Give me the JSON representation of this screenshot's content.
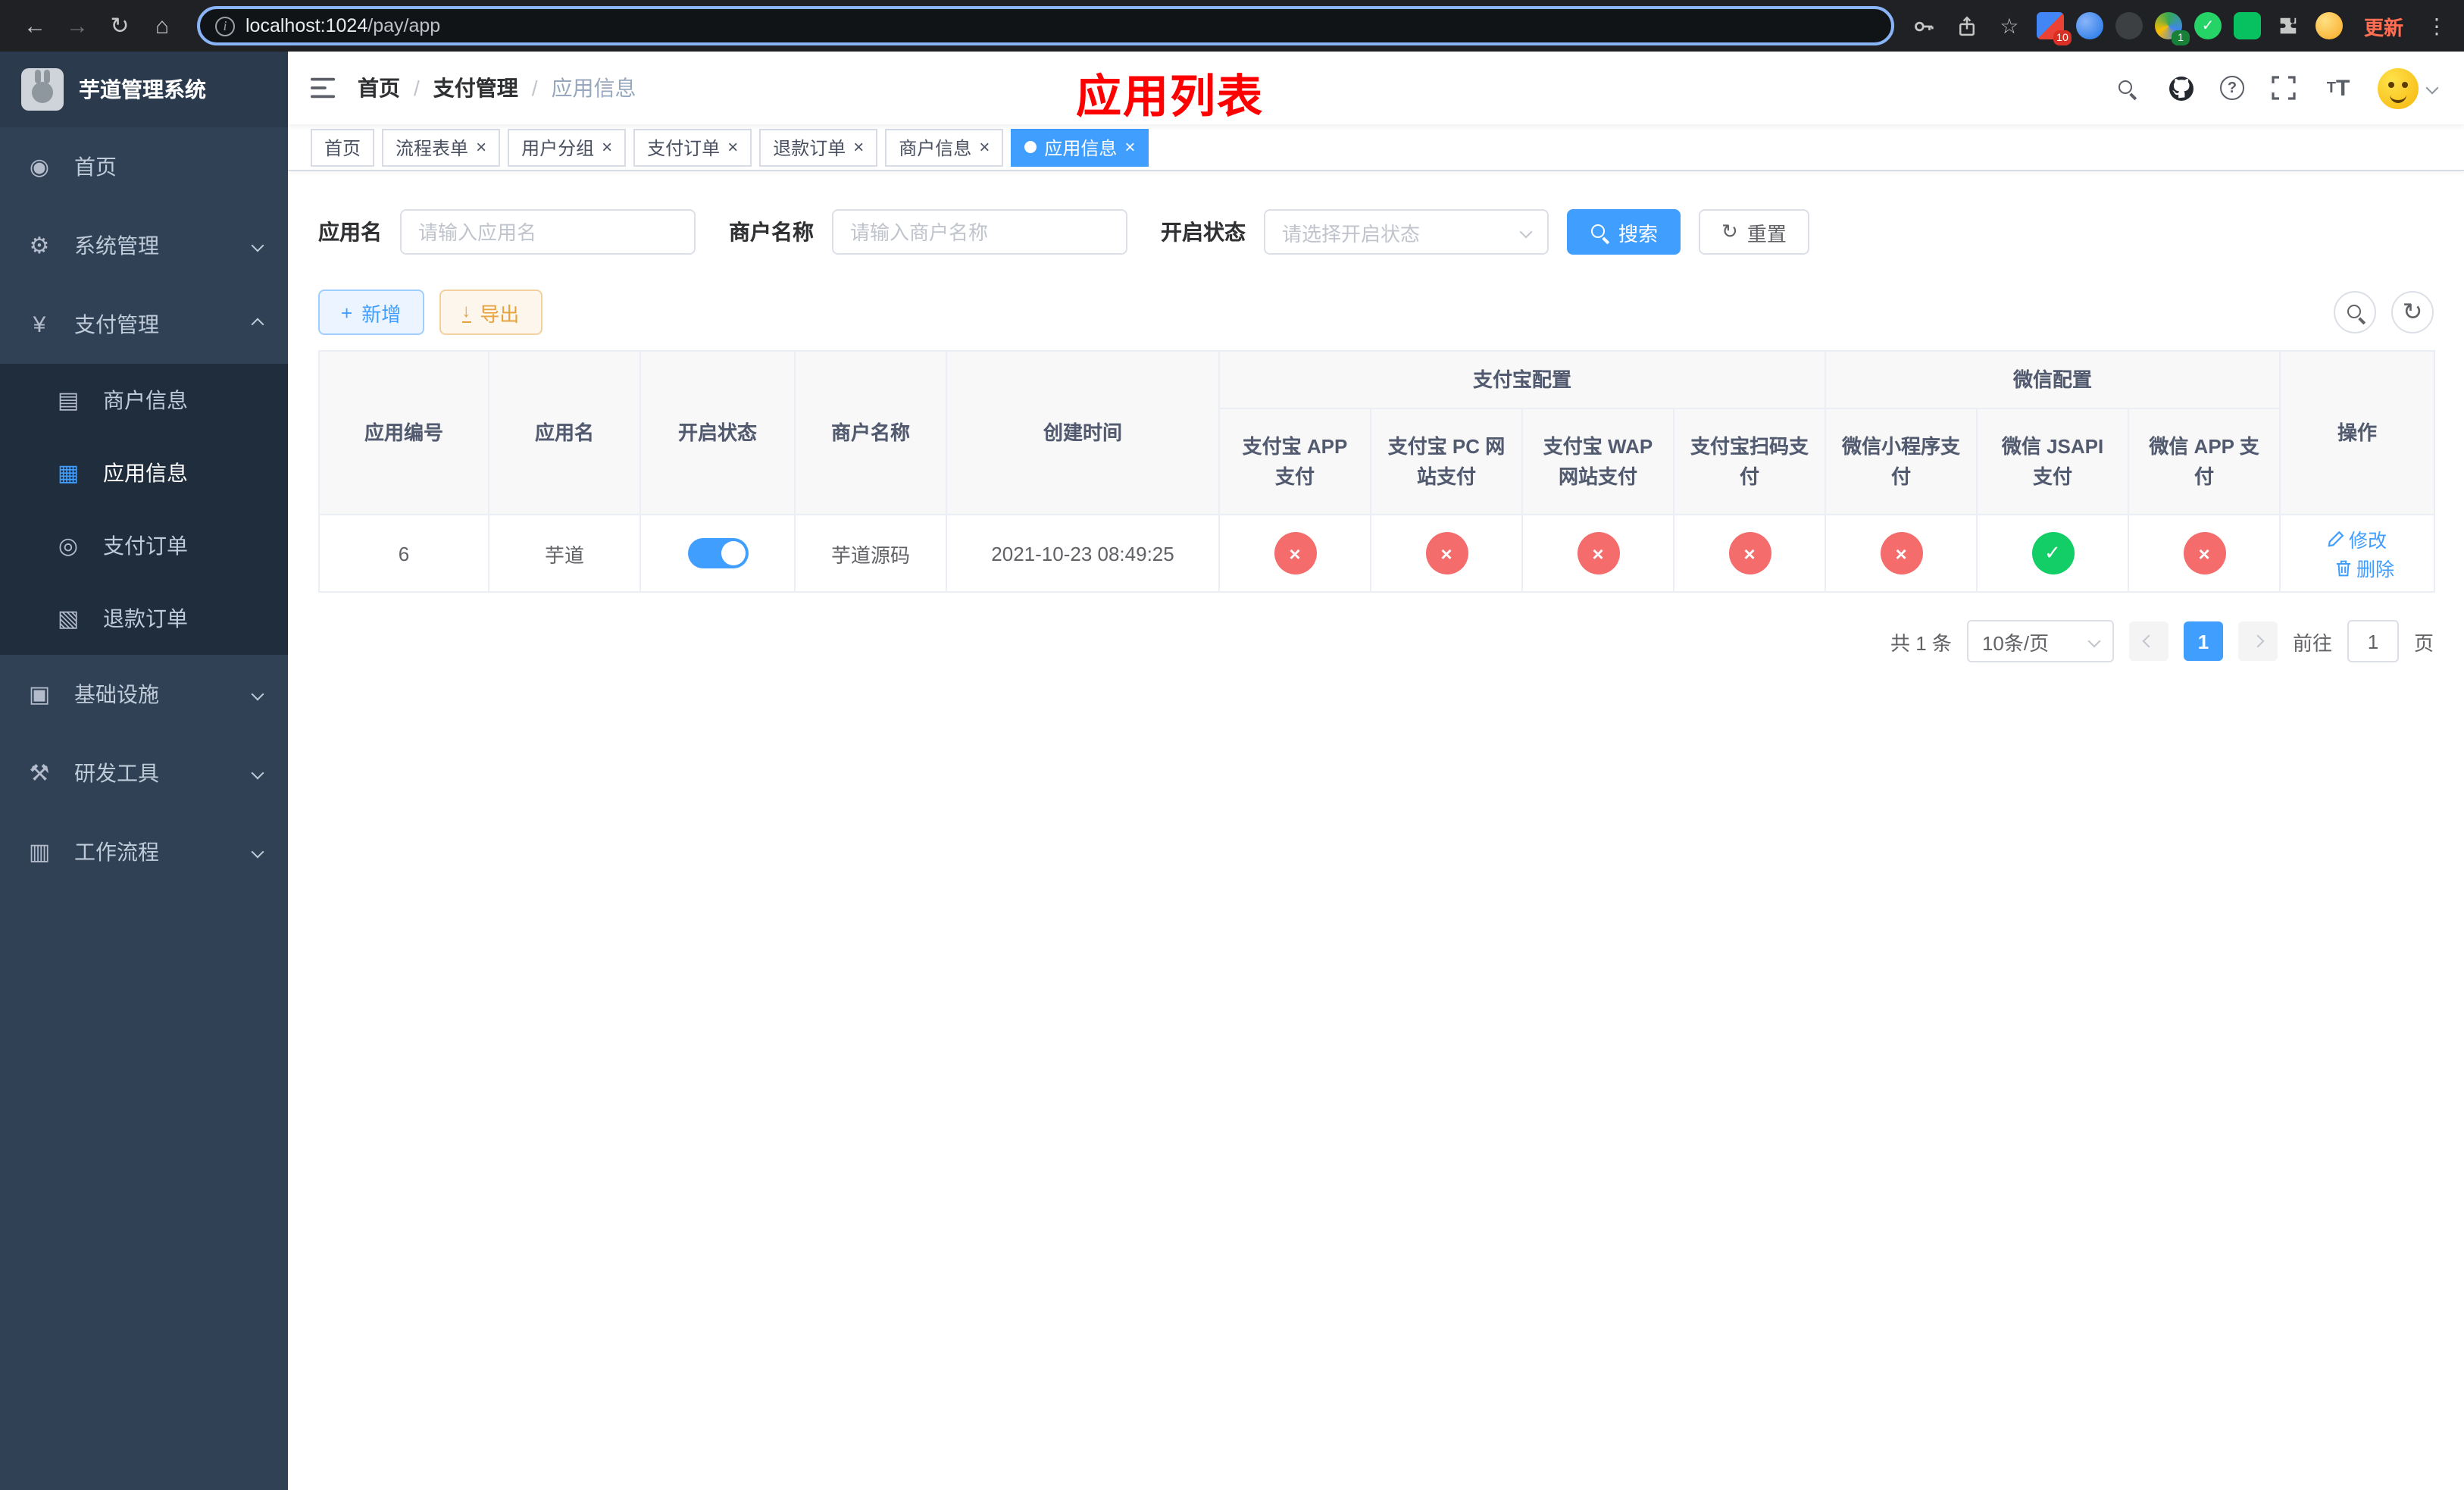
{
  "browser": {
    "url_host": "localhost:1024",
    "url_path": "/pay/app",
    "update_label": "更新",
    "ext_badge_blocks": "10",
    "ext_badge_multi": "1"
  },
  "icons": {
    "back_arrow": "←",
    "forward_arrow": "→",
    "reload": "↻",
    "home": "⌂",
    "star": "☆",
    "more_vertical": "⋮",
    "question": "?",
    "font_size_big": "T",
    "font_size_small": "T",
    "close": "×",
    "plus": "+",
    "download_arrow": "↓",
    "refresh": "↻",
    "check": "✓",
    "cross": "×"
  },
  "sidebar": {
    "app_title": "芋道管理系统",
    "items": [
      {
        "label": "首页",
        "icon_glyph": "◉"
      },
      {
        "label": "系统管理",
        "icon_glyph": "⚙"
      },
      {
        "label": "支付管理",
        "icon_glyph": "¥"
      },
      {
        "label": "商户信息",
        "icon_glyph": "▤"
      },
      {
        "label": "应用信息",
        "icon_glyph": "▦"
      },
      {
        "label": "支付订单",
        "icon_glyph": "◎"
      },
      {
        "label": "退款订单",
        "icon_glyph": "▧"
      },
      {
        "label": "基础设施",
        "icon_glyph": "▣"
      },
      {
        "label": "研发工具",
        "icon_glyph": "⚒"
      },
      {
        "label": "工作流程",
        "icon_glyph": "▥"
      }
    ]
  },
  "header": {
    "breadcrumb": [
      {
        "label": "首页"
      },
      {
        "label": "支付管理"
      },
      {
        "label": "应用信息"
      }
    ],
    "breadcrumb_separator": "/",
    "annotation": "应用列表"
  },
  "tabs": [
    {
      "label": "首页"
    },
    {
      "label": "流程表单"
    },
    {
      "label": "用户分组"
    },
    {
      "label": "支付订单"
    },
    {
      "label": "退款订单"
    },
    {
      "label": "商户信息"
    },
    {
      "label": "应用信息",
      "active": true
    }
  ],
  "filters": {
    "app_name_label": "应用名",
    "app_name_placeholder": "请输入应用名",
    "merchant_label": "商户名称",
    "merchant_placeholder": "请输入商户名称",
    "status_label": "开启状态",
    "status_placeholder": "请选择开启状态",
    "search_label": "搜索",
    "reset_label": "重置"
  },
  "toolbar": {
    "add_label": "新增",
    "export_label": "导出"
  },
  "table": {
    "columns_fixed": [
      "应用编号",
      "应用名",
      "开启状态",
      "商户名称",
      "创建时间"
    ],
    "alipay_group_label": "支付宝配置",
    "alipay_columns": [
      "支付宝 APP 支付",
      "支付宝 PC 网站支付",
      "支付宝 WAP 网站支付",
      "支付宝扫码支付"
    ],
    "wechat_group_label": "微信配置",
    "wechat_columns": [
      "微信小程序支付",
      "微信 JSAPI 支付",
      "微信 APP 支付"
    ],
    "ops_label": "操作",
    "row": {
      "id": "6",
      "name": "芋道",
      "enabled": true,
      "merchant": "芋道源码",
      "created_at": "2021-10-23 08:49:25",
      "statuses": [
        "fail",
        "fail",
        "fail",
        "fail",
        "fail",
        "success",
        "fail"
      ],
      "edit_label": "修改",
      "delete_label": "删除"
    }
  },
  "pagination": {
    "total_label": "共 1 条",
    "page_size_label": "10条/页",
    "current_page": "1",
    "goto_label": "前往",
    "goto_value": "1",
    "unit_label": "页"
  },
  "colors": {
    "primary": "#409eff",
    "success": "#13ce66",
    "danger": "#f56c6c",
    "warning": "#e6a23c",
    "annotation_red": "#ff0000",
    "sidebar_bg": "#304156",
    "submenu_bg": "#1f2d3d"
  }
}
